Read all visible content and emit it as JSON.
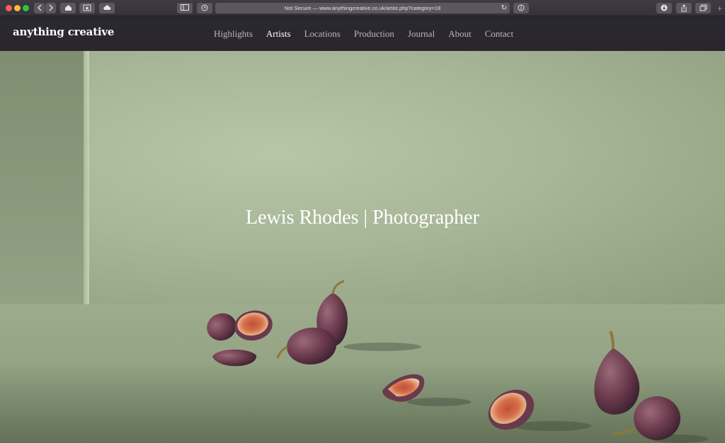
{
  "browser": {
    "address_text": "Not Secure — www.anythingcreative.co.uk/artist.php?category=18",
    "traffic_lights": [
      "#ff5f57",
      "#febc2e",
      "#28c840"
    ]
  },
  "site": {
    "logo": "anything creative",
    "nav": [
      {
        "label": "Highlights",
        "active": false
      },
      {
        "label": "Artists",
        "active": true
      },
      {
        "label": "Locations",
        "active": false
      },
      {
        "label": "Production",
        "active": false
      },
      {
        "label": "Journal",
        "active": false
      },
      {
        "label": "About",
        "active": false
      },
      {
        "label": "Contact",
        "active": false
      }
    ]
  },
  "hero": {
    "title": "Lewis Rhodes | Photographer"
  }
}
